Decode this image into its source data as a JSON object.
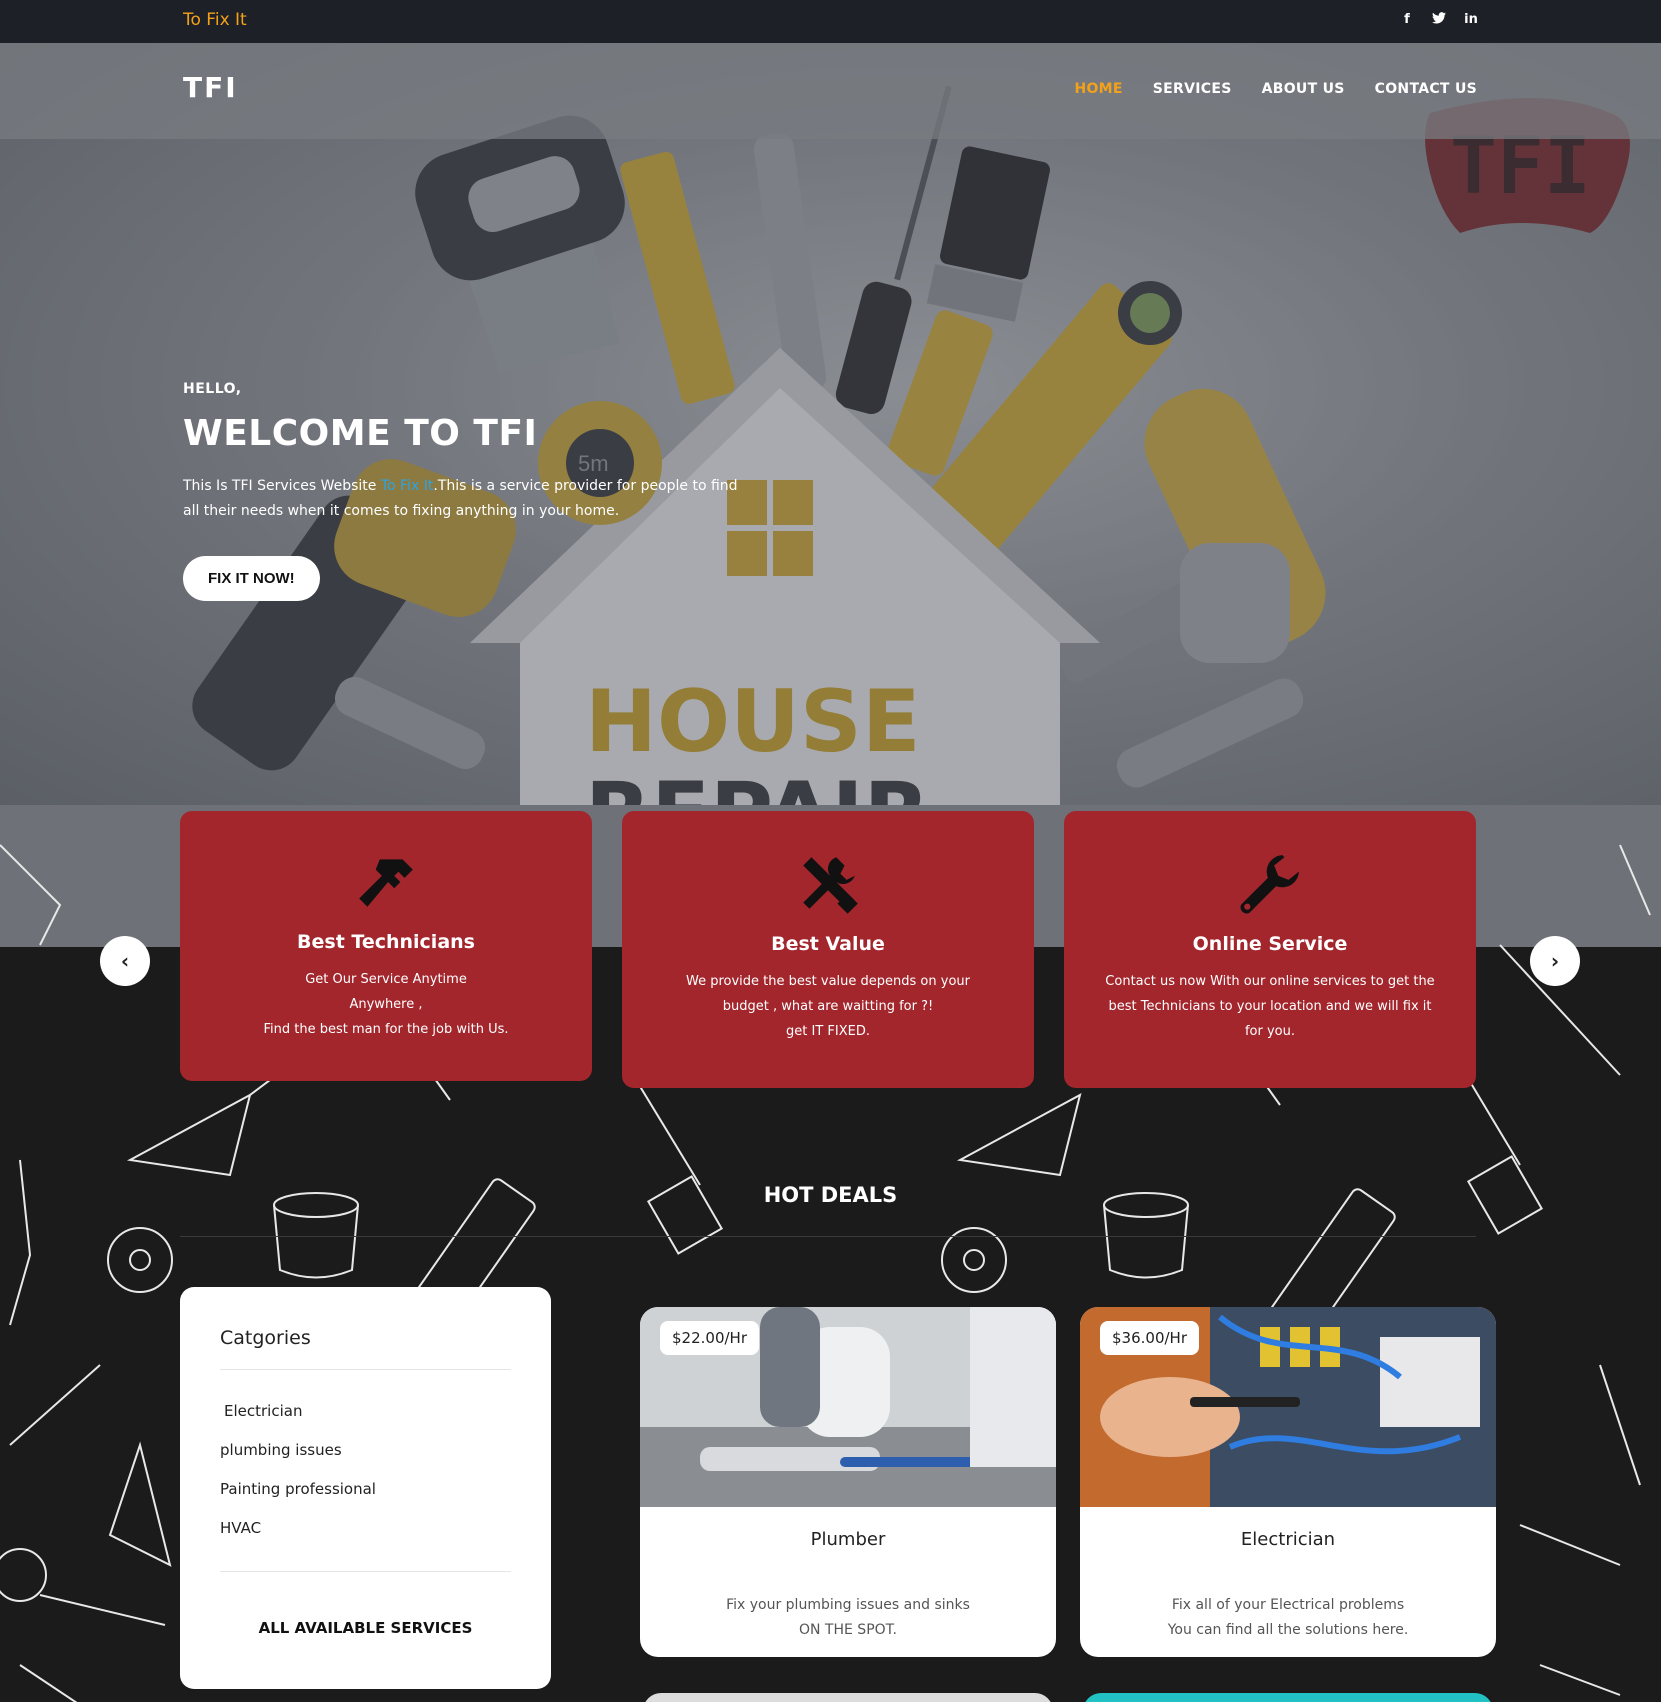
{
  "topbar": {
    "brand": "To Fix It",
    "social": [
      "f",
      "t",
      "in"
    ]
  },
  "nav": {
    "logo": "TFI",
    "items": [
      {
        "label": "HOME",
        "active": true
      },
      {
        "label": "SERVICES",
        "active": false
      },
      {
        "label": "ABOUT US",
        "active": false
      },
      {
        "label": "CONTACT US",
        "active": false
      }
    ]
  },
  "hero": {
    "hello": "HELLO,",
    "title": "WELCOME TO TFI",
    "desc_before": "This Is TFI Services Website ",
    "desc_link": "To Fix It",
    "desc_after": ".This is a service provider for people to find all their needs when it comes to fixing anything in your home.",
    "cta": "FIX IT NOW!",
    "badge_text": "TFI",
    "art_text_1": "HOUSE",
    "art_text_2": "REPAIR",
    "tape_text": "5m"
  },
  "features": [
    {
      "icon": "hammer-icon",
      "title": "Best Technicians",
      "lines": [
        "Get Our Service Anytime",
        "Anywhere ,",
        "Find the best man for the job with Us."
      ]
    },
    {
      "icon": "tools-icon",
      "title": "Best Value",
      "lines": [
        "We provide the best value depends on your",
        "budget , what are waitting for ?!",
        "get IT FIXED."
      ]
    },
    {
      "icon": "wrench-icon",
      "title": "Online Service",
      "lines": [
        "Contact us now With our online services to get the",
        "best Technicians to your location and we will fix it",
        "for you."
      ]
    }
  ],
  "carousel": {
    "prev": "‹",
    "next": "›"
  },
  "deals": {
    "title": "HOT DEALS",
    "categories": {
      "heading": "Catgories",
      "items": [
        "Electrician",
        "plumbing issues",
        "Painting professional",
        "HVAC"
      ],
      "all": "ALL AVAILABLE SERVICES"
    },
    "cards": [
      {
        "price": "$22.00/Hr",
        "title": "Plumber",
        "lines": [
          "Fix your plumbing issues and sinks",
          "ON THE SPOT."
        ]
      },
      {
        "price": "$36.00/Hr",
        "title": "Electrician",
        "lines": [
          "Fix all of your Electrical problems",
          "You can find all the solutions here."
        ]
      }
    ]
  },
  "colors": {
    "accent": "#f4a11a",
    "feature_red": "#a3262d",
    "link_blue": "#2aa4e8",
    "dark_bg": "#1b1b1b"
  }
}
